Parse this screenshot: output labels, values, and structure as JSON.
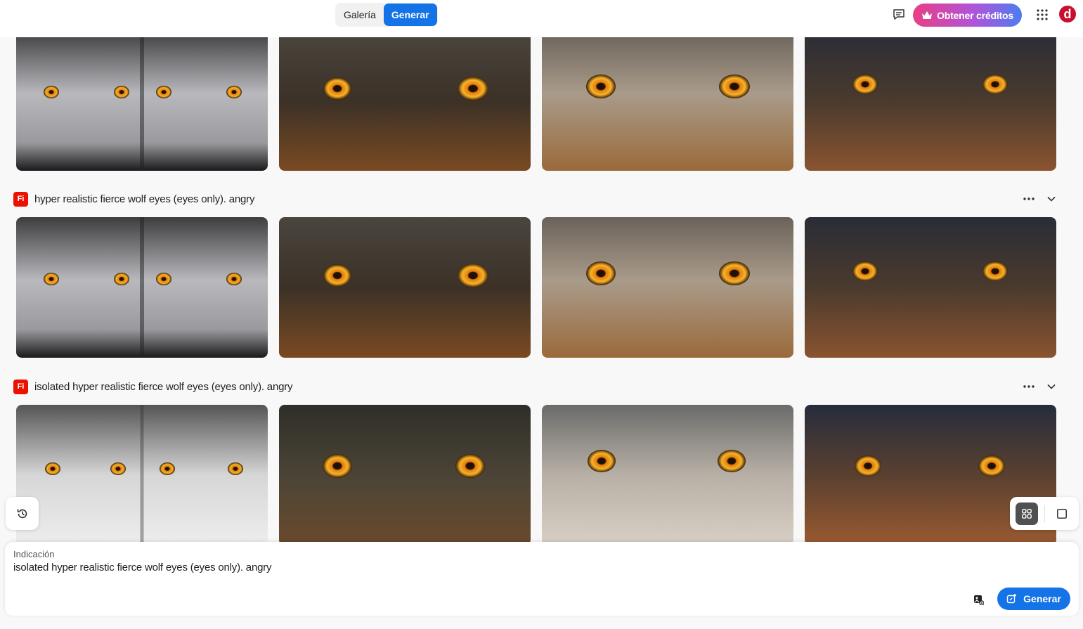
{
  "header": {
    "tabs": [
      {
        "label": "Galería",
        "active": false
      },
      {
        "label": "Generar",
        "active": true
      }
    ],
    "credits_label": "Obtener créditos",
    "avatar_letter": "d"
  },
  "groups": [
    {
      "prompt": "",
      "images": [
        "wolf-eyes-mirrored-gray",
        "wolf-eyes-brown-dark",
        "wolf-eyes-light-gray",
        "wolf-eyes-dark-rust"
      ]
    },
    {
      "prompt": "hyper realistic fierce wolf eyes (eyes only). angry",
      "badge": "Fi",
      "images": [
        "wolf-eyes-mirrored-gray",
        "wolf-eyes-brown-dark",
        "wolf-eyes-light-gray",
        "wolf-eyes-dark-rust"
      ]
    },
    {
      "prompt": "isolated hyper realistic fierce wolf eyes (eyes only). angry",
      "badge": "Fi",
      "images": [
        "wolf-eyes-mirrored-white",
        "wolf-eyes-dark-olive",
        "wolf-eyes-white-gray",
        "wolf-eyes-navy-rust"
      ]
    }
  ],
  "prompt_panel": {
    "label": "Indicación",
    "value": "isolated hyper realistic fierce wolf eyes (eyes only). angry",
    "generate_label": "Generar"
  },
  "colors": {
    "accent": "#1473e6",
    "firefly_badge": "#eb1000",
    "eye_orange": "#f2a21a"
  }
}
